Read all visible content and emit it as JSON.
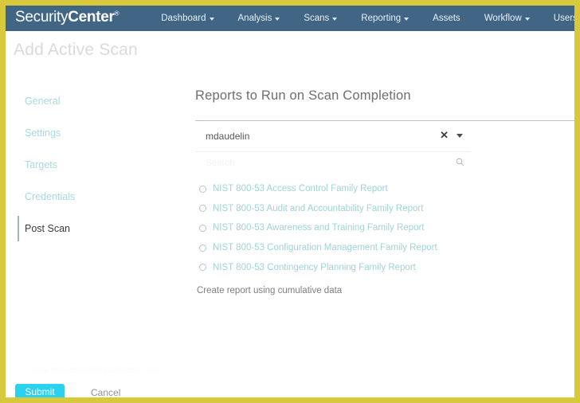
{
  "nav": {
    "logo_light": "Security",
    "logo_bold": "Center",
    "logo_reg": "®",
    "items": [
      {
        "label": "Dashboard",
        "caret": true
      },
      {
        "label": "Analysis",
        "caret": true
      },
      {
        "label": "Scans",
        "caret": true
      },
      {
        "label": "Reporting",
        "caret": true
      },
      {
        "label": "Assets",
        "caret": false
      },
      {
        "label": "Workflow",
        "caret": true
      },
      {
        "label": "Users",
        "caret": true
      }
    ]
  },
  "page": {
    "title": "Add Active Scan"
  },
  "sidebar": {
    "items": [
      {
        "label": "General",
        "active": false
      },
      {
        "label": "Settings",
        "active": false
      },
      {
        "label": "Targets",
        "active": false
      },
      {
        "label": "Credentials",
        "active": false
      },
      {
        "label": "Post Scan",
        "active": true
      }
    ]
  },
  "main": {
    "heading": "Reports to Run on Scan Completion",
    "selected_value": "mdaudelin",
    "clear_glyph": "✕",
    "search": {
      "value": "",
      "placeholder": "Search"
    },
    "options": [
      {
        "label": "NIST 800-53 Access Control Family Report",
        "selected": false
      },
      {
        "label": "NIST 800-53 Audit and Accountability Family Report",
        "selected": false
      },
      {
        "label": "NIST 800-53 Awareness and Training Family Report",
        "selected": false
      },
      {
        "label": "NIST 800-53 Configuration Management Family Report",
        "selected": false
      },
      {
        "label": "NIST 800-53 Contingency Planning Family Report",
        "selected": false
      }
    ],
    "cumulative_label": "Create report using cumulative data"
  },
  "watermark": "www.templatesofficecollection.com",
  "footer": {
    "submit_label": "Submit",
    "cancel_label": "Cancel"
  },
  "colors": {
    "navbar": "#416685",
    "frame": "#d8c83c",
    "accent_link": "#9fd3d8",
    "submit": "#2ad2f0",
    "active_text": "#3b3b3b"
  }
}
